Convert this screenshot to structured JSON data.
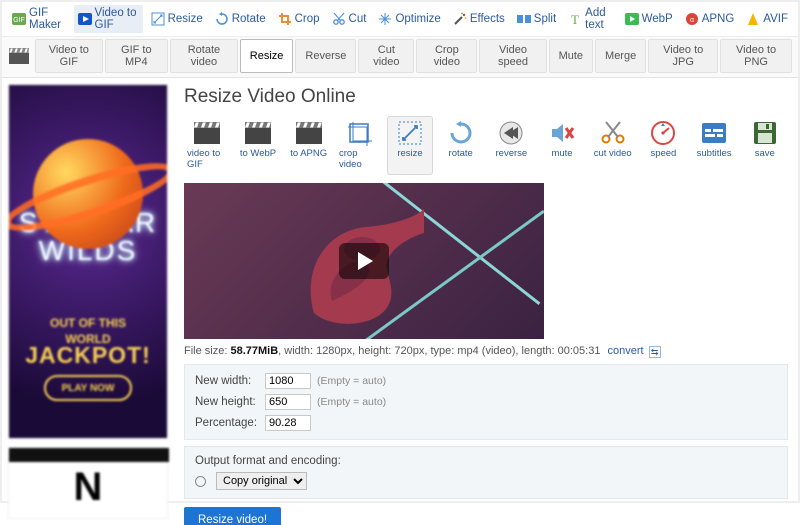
{
  "toolbar1": [
    {
      "icon": "gif",
      "label": "GIF Maker",
      "color": "#6aa84f"
    },
    {
      "icon": "video",
      "label": "Video to GIF",
      "color": "#1155cc",
      "active": true
    },
    {
      "icon": "resize",
      "label": "Resize",
      "color": "#4a90d9"
    },
    {
      "icon": "rotate",
      "label": "Rotate",
      "color": "#4a90d9"
    },
    {
      "icon": "crop",
      "label": "Crop",
      "color": "#e69138"
    },
    {
      "icon": "cut",
      "label": "Cut",
      "color": "#4a90d9"
    },
    {
      "icon": "optimize",
      "label": "Optimize",
      "color": "#4a90d9"
    },
    {
      "icon": "effects",
      "label": "Effects",
      "color": "#cc4125"
    },
    {
      "icon": "split",
      "label": "Split",
      "color": "#4a90d9"
    },
    {
      "icon": "text",
      "label": "Add text",
      "color": "#6aa84f"
    },
    {
      "icon": "webp",
      "label": "WebP",
      "color": "#3cba54",
      "box": true
    },
    {
      "icon": "apng",
      "label": "APNG",
      "color": "#db4437",
      "box": true
    },
    {
      "icon": "avif",
      "label": "AVIF",
      "color": "#f4b400"
    }
  ],
  "toolbar2": [
    "Video to GIF",
    "GIF to MP4",
    "Rotate video",
    "Resize",
    "Reverse",
    "Cut video",
    "Crop video",
    "Video speed",
    "Mute",
    "Merge",
    "Video to JPG",
    "Video to PNG"
  ],
  "toolbar2_active": "Resize",
  "title": "Resize Video Online",
  "iconrow": [
    {
      "k": "video to GIF",
      "ic": "clap"
    },
    {
      "k": "to WebP",
      "ic": "clap"
    },
    {
      "k": "to APNG",
      "ic": "clap"
    },
    {
      "k": "crop video",
      "ic": "crop"
    },
    {
      "k": "resize",
      "ic": "resize",
      "active": true
    },
    {
      "k": "rotate",
      "ic": "rot"
    },
    {
      "k": "reverse",
      "ic": "rev"
    },
    {
      "k": "mute",
      "ic": "mute"
    },
    {
      "k": "cut video",
      "ic": "sciss"
    },
    {
      "k": "speed",
      "ic": "spd"
    },
    {
      "k": "subtitles",
      "ic": "sub"
    },
    {
      "k": "save",
      "ic": "save"
    }
  ],
  "file": {
    "prefix": "File size: ",
    "size": "58.77MiB",
    "rest": ", width: 1280px, height: 720px, type: mp4 (video), length: 00:05:31",
    "convert": "convert"
  },
  "form": {
    "width_label": "New width:",
    "width_val": "1080",
    "hint": "(Empty = auto)",
    "height_label": "New height:",
    "height_val": "650",
    "pct_label": "Percentage:",
    "pct_val": "90.28",
    "out_label": "Output format and encoding:",
    "out_select": "Copy original",
    "submit": "Resize video!"
  },
  "ad": {
    "title1": "STELLAR",
    "title2": "WILDS",
    "mid": "OUT OF THIS\nWORLD",
    "jack": "JACKPOT!",
    "play": "PLAY NOW"
  }
}
